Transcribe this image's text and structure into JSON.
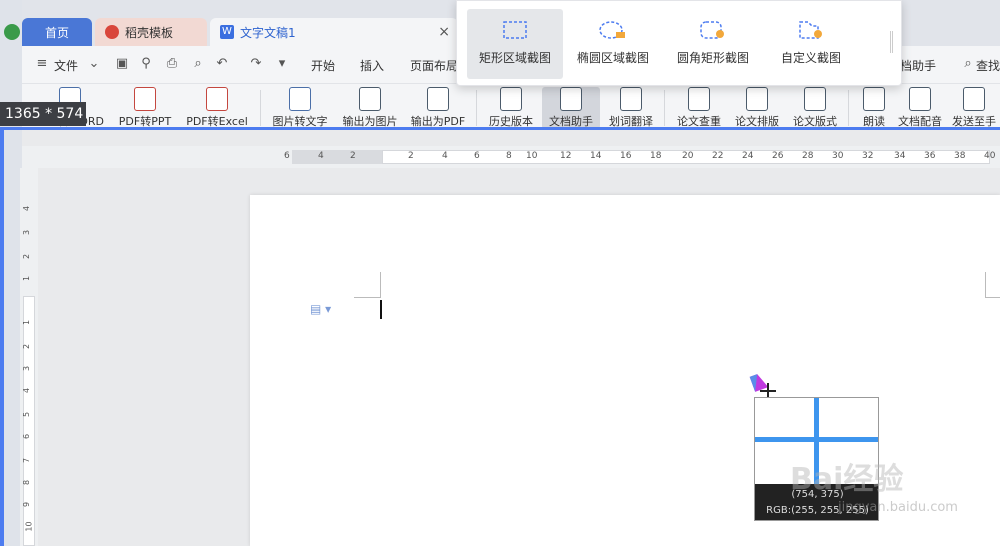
{
  "tabs": {
    "home": "首页",
    "templates": "稻壳模板",
    "document": "文字文稿1",
    "close": "×"
  },
  "menu": {
    "file": "文件",
    "items": [
      "开始",
      "插入",
      "页面布局"
    ],
    "assistant": "档助手",
    "search": "查找"
  },
  "ribbon": {
    "buttons": [
      "PDF转WORD",
      "PDF转PPT",
      "PDF转Excel",
      "图片转文字",
      "输出为图片",
      "输出为PDF",
      "历史版本",
      "文档助手",
      "划词翻译",
      "论文查重",
      "论文排版",
      "论文版式",
      "朗读",
      "文档配音",
      "发送至手"
    ]
  },
  "selection": {
    "dimensions": "1365 * 574",
    "accent_color": "#4d7cf0"
  },
  "screenshot_popup": {
    "options": [
      "矩形区域截图",
      "椭圆区域截图",
      "圆角矩形截图",
      "自定义截图"
    ],
    "selected_index": 0
  },
  "ruler": {
    "h_labels": [
      "6",
      "4",
      "2",
      "2",
      "4",
      "6",
      "8",
      "10",
      "12",
      "14",
      "16",
      "18",
      "20",
      "22",
      "24",
      "26",
      "28",
      "30",
      "32",
      "34",
      "36",
      "38",
      "40"
    ],
    "v_labels": [
      "4",
      "3",
      "2",
      "1",
      "1",
      "2",
      "3",
      "4",
      "5",
      "6",
      "7",
      "8",
      "9",
      "10"
    ]
  },
  "magnifier": {
    "coords": "(754, 375)",
    "rgb": "RGB:(255, 255, 255)"
  },
  "watermark": {
    "text": "Bai经验",
    "sub": "jingyan.baidu.com"
  }
}
